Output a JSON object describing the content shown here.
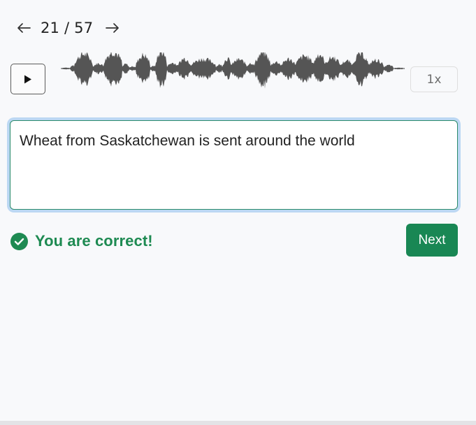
{
  "navigation": {
    "prev_icon": "arrow-left-icon",
    "next_icon": "arrow-right-icon",
    "current": "21",
    "separator": "/",
    "total": "57",
    "counter_text": "21 / 57"
  },
  "player": {
    "play_icon": "play-icon",
    "waveform": "audio-waveform",
    "speed_label": "1x"
  },
  "answer": {
    "value": "Wheat from Saskatchewan is sent around the world"
  },
  "feedback": {
    "icon": "check-circle-icon",
    "message": "You are correct!",
    "status_color": "#1e8a52"
  },
  "actions": {
    "next_label": "Next",
    "next_color": "#198754"
  },
  "colors": {
    "background": "#f8f9fb",
    "waveform": "#555555",
    "focus_ring": "#bcd8f3",
    "input_border": "#2a8a6b"
  }
}
